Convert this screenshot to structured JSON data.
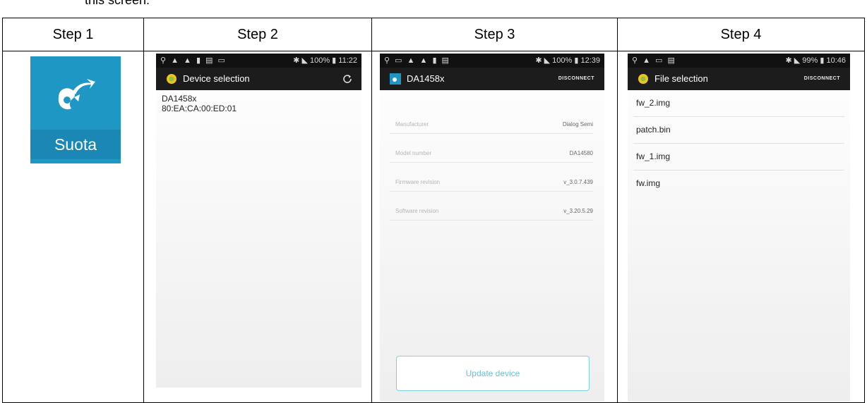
{
  "intro_text": "this screen.",
  "steps": [
    "Step 1",
    "Step 2",
    "Step 3",
    "Step 4"
  ],
  "step1": {
    "app_label": "Suota"
  },
  "step2": {
    "status_time": "11:22",
    "status_battery": "100%",
    "title": "Device selection",
    "device_name": "DA1458x",
    "device_address": "80:EA:CA:00:ED:01"
  },
  "step3": {
    "status_time": "12:39",
    "status_battery": "100%",
    "title": "DA1458x",
    "action": "DISCONNECT",
    "info": [
      {
        "label": "Manufacturer",
        "value": "Dialog Semi"
      },
      {
        "label": "Model number",
        "value": "DA14580"
      },
      {
        "label": "Firmware revision",
        "value": "v_3.0.7.439"
      },
      {
        "label": "Software revision",
        "value": "v_3.20.5.29"
      }
    ],
    "button": "Update device"
  },
  "step4": {
    "status_time": "10:46",
    "status_battery": "99%",
    "title": "File selection",
    "action": "DISCONNECT",
    "files": [
      "fw_2.img",
      "patch.bin",
      "fw_1.img",
      "fw.img"
    ]
  },
  "colors": {
    "app_icon_bg": "#1f97c5",
    "actionbar": "#1c1c1c",
    "update_button_border": "#7fd0e6"
  },
  "icons": {
    "app": "suota-logo-icon",
    "actionbar_app": "android-icon",
    "refresh": "refresh-icon"
  }
}
